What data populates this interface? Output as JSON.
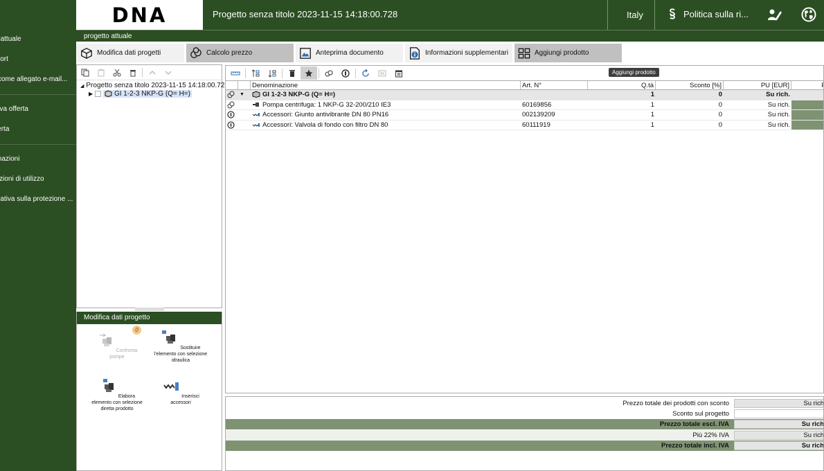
{
  "sidebar": {
    "items": [
      {
        "label": "Progetto attuale"
      },
      {
        "label": "Export"
      },
      {
        "label": "Invia come allegato e-mail..."
      },
      {
        "label": "Salva offerta"
      },
      {
        "label": "Offerta"
      },
      {
        "label": "Informazioni"
      },
      {
        "label": "Condizioni di utilizzo"
      },
      {
        "label": "Informativa sulla protezione ..."
      }
    ]
  },
  "header": {
    "logo": "DNA",
    "title": "Progetto senza titolo 2023-11-15 14:18:00.728",
    "region": "Italy",
    "policy": "Politica sulla ri..."
  },
  "breadcrumb": "progetto attuale",
  "tabs": [
    {
      "label": "Modifica dati progetti"
    },
    {
      "label": "Calcolo prezzo"
    },
    {
      "label": "Anteprima documento"
    },
    {
      "label": "Informazioni supplementari"
    },
    {
      "label": "Aggiungi prodotto"
    }
  ],
  "tree": {
    "root": "Progetto senza titolo 2023-11-15 14:18:00.72",
    "child": "GI 1-2-3 NKP-G (Q= H=)"
  },
  "modify_panel": {
    "title": "Modifica dati progetto",
    "badge": "0",
    "actions": [
      {
        "label": "Confronta pompe"
      },
      {
        "label": "Sostituire l'elemento con selezione idraulica"
      },
      {
        "label": "Elabora elemento con selezione diretta prodotto"
      },
      {
        "label": "Inserisci accessori"
      }
    ]
  },
  "table": {
    "tooltip": "Aggiungi prodotto",
    "columns": [
      "Denominazione",
      "Art. N°",
      "Q.tà",
      "Sconto [%]",
      "PU [EUR]",
      "Pre"
    ],
    "rows": [
      {
        "name": "GI 1-2-3 NKP-G         (Q=  H=)",
        "art": "",
        "qty": "1",
        "discount": "0",
        "pu": "Su rich."
      },
      {
        "name": "Pompa centrifuga: 1 NKP-G 32-200/210  IE3",
        "art": "60169856",
        "qty": "1",
        "discount": "0",
        "pu": "Su rich."
      },
      {
        "name": "Accessori: Giunto antivibrante DN 80 PN16",
        "art": "002139209",
        "qty": "1",
        "discount": "0",
        "pu": "Su rich."
      },
      {
        "name": "Accessori: Valvola di fondo con filtro DN 80",
        "art": "60111919",
        "qty": "1",
        "discount": "0",
        "pu": "Su rich."
      }
    ]
  },
  "summary": {
    "rows": [
      {
        "label": "Prezzo totale dei prodotti con sconto",
        "value": "Su rich"
      },
      {
        "label": "Sconto sul progetto",
        "value": ""
      },
      {
        "label": "Prezzo totale escl. IVA",
        "value": "Su rich"
      },
      {
        "label": "Più 22% IVA",
        "value": "Su rich"
      },
      {
        "label": "Prezzo totale incl. IVA",
        "value": "Su rich"
      }
    ]
  },
  "colors": {
    "brand_green": "#2b4e22",
    "table_shade": "#7f9373",
    "tab_selected": "#c0c0c0"
  }
}
